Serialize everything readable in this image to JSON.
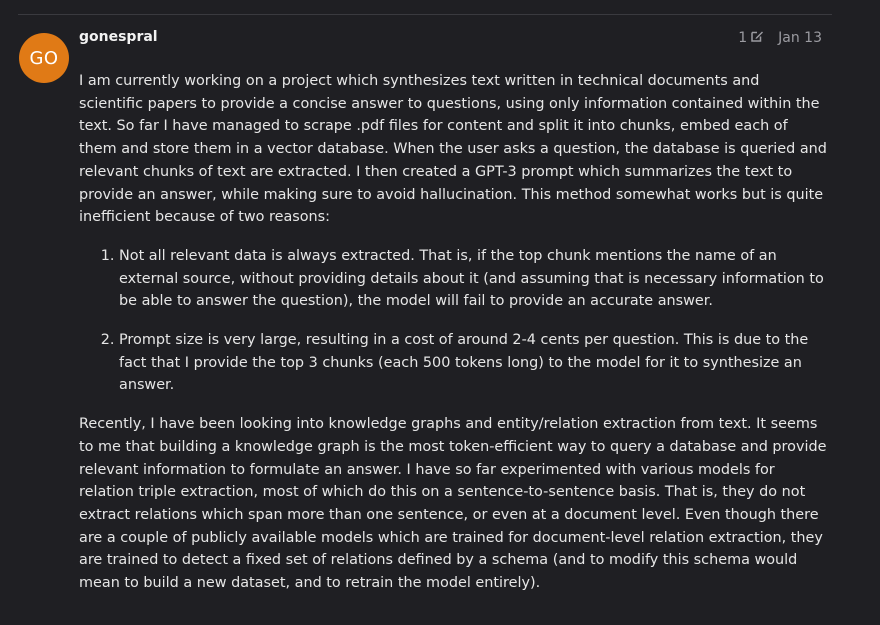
{
  "post": {
    "avatar_initials": "GO",
    "username": "gonespral",
    "edit_count": "1",
    "date": "Jan 13",
    "paragraph_1": "I am currently working on a project which synthesizes text written in technical documents and scientific papers to provide a concise answer to questions, using only information contained within the text. So far I have managed to scrape .pdf files for content and split it into chunks, embed each of them and store them in a vector database. When the user asks a question, the database is queried and relevant chunks of text are extracted. I then created a GPT-3 prompt which summarizes the text to provide an answer, while making sure to avoid hallucination. This method somewhat works but is quite inefficient because of two reasons:",
    "list_items": [
      "Not all relevant data is always extracted. That is, if the top chunk mentions the name of an external source, without providing details about it (and assuming that is necessary information to be able to answer the question), the model will fail to provide an accurate answer.",
      "Prompt size is very large, resulting in a cost of around 2-4 cents per question. This is due to the fact that I provide the top 3 chunks (each 500 tokens long) to the model for it to synthesize an answer."
    ],
    "paragraph_2": "Recently, I have been looking into knowledge graphs and entity/relation extraction from text. It seems to me that building a knowledge graph is the most token-efficient way to query a database and provide relevant information to formulate an answer. I have so far experimented with various models for relation triple extraction, most of which do this on a sentence-to-sentence basis. That is, they do not extract relations which span more than one sentence, or even at a document level. Even though there are a couple of publicly available models which are trained for document-level relation extraction, they are trained to detect a fixed set of relations defined by a schema (and to modify this schema would mean to build a new dataset, and to retrain the model entirely)."
  },
  "colors": {
    "background": "#1f1f23",
    "avatar": "#e07a16",
    "muted_text": "#9b9ba1",
    "body_text": "#e6e6e6"
  },
  "icons": {
    "edit": "pencil-icon"
  }
}
